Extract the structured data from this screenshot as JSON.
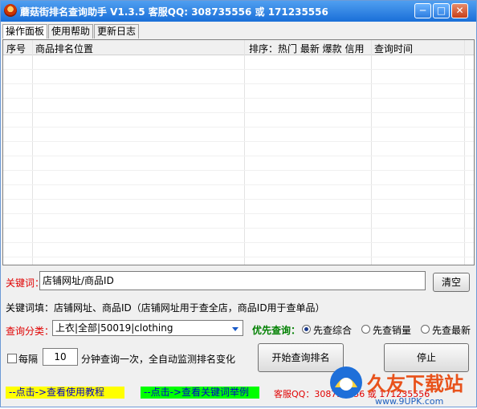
{
  "window": {
    "title": "蘑菇街排名查询助手 V1.3.5 客服QQ: 308735556 或 171235556",
    "minimize_glyph": "─",
    "maximize_glyph": "□",
    "close_glyph": "✕"
  },
  "tabs": [
    {
      "label": "操作面板"
    },
    {
      "label": "使用帮助"
    },
    {
      "label": "更新日志"
    }
  ],
  "table": {
    "columns": [
      "序号",
      "商品排名位置",
      "排序：热门 最新 爆款 信用",
      "查询时间"
    ],
    "rows": []
  },
  "keyword": {
    "label": "关键词：",
    "value": "店铺网址/商品ID",
    "clear_button": "清空",
    "hint": "关键词填：店铺网址、商品ID（店铺网址用于查全店，商品ID用于查单品）"
  },
  "category": {
    "label": "查询分类：",
    "value": "上衣|全部|50019|clothing"
  },
  "priority": {
    "label": "优先查询：",
    "options": [
      {
        "label": "先查综合",
        "selected": true
      },
      {
        "label": "先查销量",
        "selected": false
      },
      {
        "label": "先查最新",
        "selected": false
      }
    ]
  },
  "interval": {
    "checkbox_label": "每隔",
    "checked": false,
    "value": "10",
    "suffix": "分钟查询一次，全自动监测排名变化"
  },
  "actions": {
    "start": "开始查询排名",
    "stop": "停止"
  },
  "footer": {
    "tutorial_link": "--点击->查看使用教程",
    "example_link": "--点击->查看关键词举例",
    "support": "客服QQ：308735556 或 171235556"
  },
  "watermark": {
    "brand": "久友下载站",
    "url": "www.9UPK.com"
  },
  "colors": {
    "title_bar": "#2a7ee0",
    "tutorial_bg": "#ffff00",
    "example_bg": "#00ff00",
    "label_red": "#e00000",
    "label_green": "#008000"
  }
}
